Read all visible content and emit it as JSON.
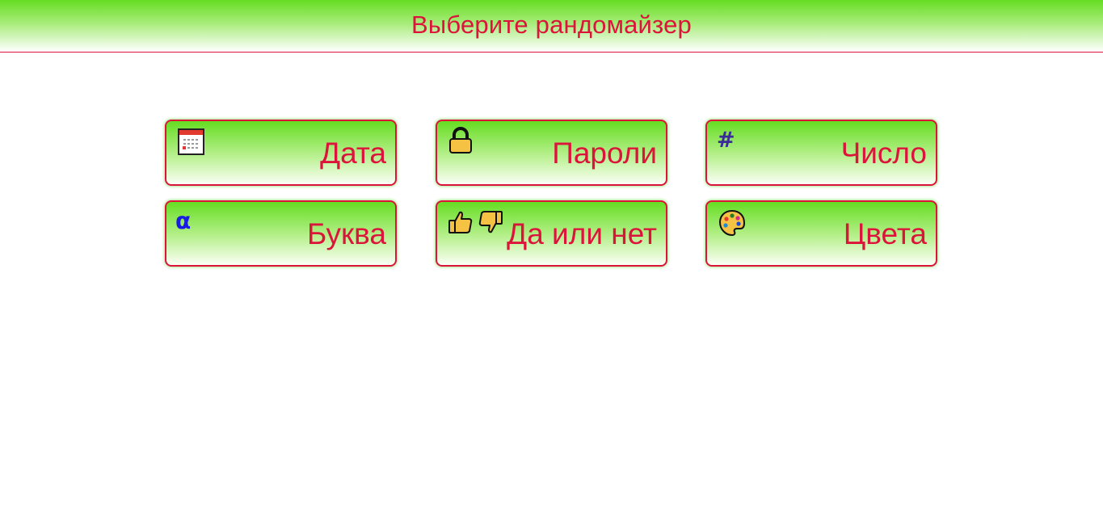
{
  "header": {
    "title": "Выберите рандомайзер"
  },
  "tiles": [
    {
      "label": "Дата",
      "icon": "calendar-icon"
    },
    {
      "label": "Пароли",
      "icon": "lock-icon"
    },
    {
      "label": "Число",
      "icon": "hash-icon",
      "glyph": "#"
    },
    {
      "label": "Буква",
      "icon": "alpha-letter-icon",
      "glyph": "α"
    },
    {
      "label": "Да или нет",
      "icon": "thumbs-up-down-icon"
    },
    {
      "label": "Цвета",
      "icon": "palette-icon"
    }
  ],
  "colors": {
    "accent_text": "#dc143c",
    "header_green": "#66dd22",
    "tile_border": "#dc143c",
    "hash_glyph": "#3a2a9a",
    "alpha_glyph": "#1a1ae6"
  }
}
